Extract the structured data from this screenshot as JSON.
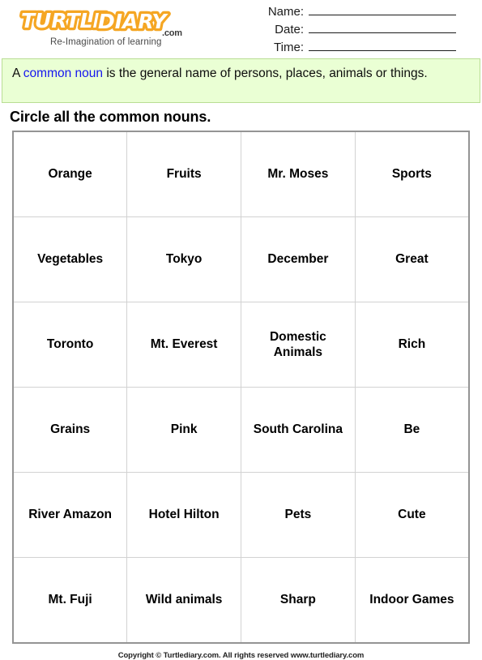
{
  "brand": {
    "logo_word_1": "TURTLE",
    "logo_word_2": "DIARY",
    "logo_suffix": ".com",
    "tagline": "Re-Imagination of learning",
    "logo_color": "#F5A623",
    "logo_fill": "#FFFFFF",
    "logo_accent": "#FFD040"
  },
  "fields": [
    {
      "label": "Name:",
      "value": ""
    },
    {
      "label": "Date:",
      "value": ""
    },
    {
      "label": "Time:",
      "value": ""
    }
  ],
  "definition": {
    "lead": "A ",
    "keyword": "common noun",
    "rest": " is the general name of persons, places, animals or things.",
    "keyword_color": "#1515EF",
    "background_color": "#EAFFD4",
    "border_color": "#B9DD94"
  },
  "instruction": "Circle all the common nouns.",
  "grid": {
    "columns": 4,
    "rows": [
      [
        "Orange",
        "Fruits",
        "Mr. Moses",
        "Sports"
      ],
      [
        "Vegetables",
        "Tokyo",
        "December",
        "Great"
      ],
      [
        "Toronto",
        "Mt. Everest",
        "Domestic Animals",
        "Rich"
      ],
      [
        "Grains",
        "Pink",
        "South Carolina",
        "Be"
      ],
      [
        "River Amazon",
        "Hotel Hilton",
        "Pets",
        "Cute"
      ],
      [
        "Mt. Fuji",
        "Wild animals",
        "Sharp",
        "Indoor Games"
      ]
    ]
  },
  "footer": "Copyright © Turtlediary.com. All rights reserved www.turtlediary.com"
}
